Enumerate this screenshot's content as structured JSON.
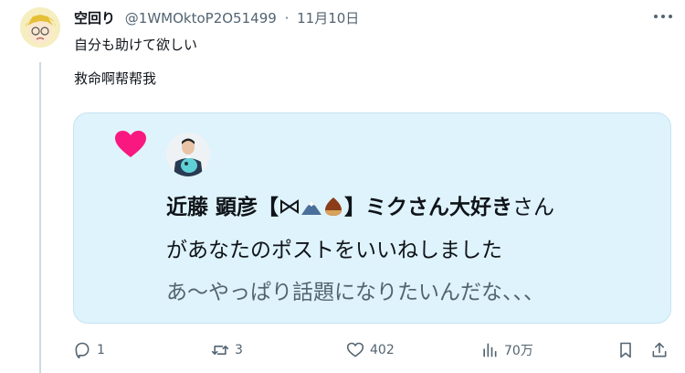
{
  "tweet": {
    "author_name": "空回り",
    "handle": "@1WMOktoP2O51499",
    "separator": "·",
    "date": "11月10日",
    "line1": "自分も助けて欲しい",
    "line2": "救命啊帮帮我"
  },
  "notification": {
    "liker_name_prefix": "近藤 顕彦【",
    "liker_name_suffix": "】ミクさん大好き",
    "title_suffix": "さん",
    "action_text": "があなたのポストをいいねしました",
    "post_excerpt": "あ〜やっぱり話題になりたいんだな、、、",
    "heart_color": "#f91880"
  },
  "actions": {
    "reply_count": "1",
    "retweet_count": "3",
    "like_count": "402",
    "views_count": "70万"
  },
  "icons": [
    "more-icon",
    "heart-icon",
    "reply-icon",
    "retweet-icon",
    "like-icon",
    "views-icon",
    "bookmark-icon",
    "share-icon"
  ]
}
